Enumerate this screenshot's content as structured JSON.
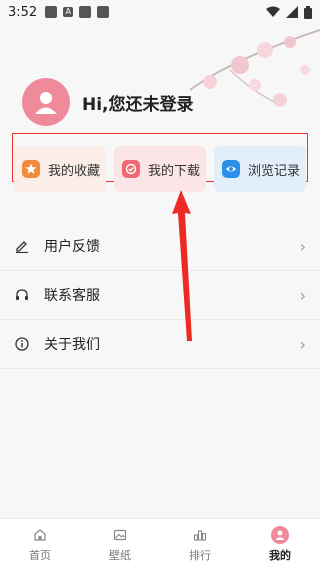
{
  "status": {
    "time": "3:52",
    "notif_letter": "A"
  },
  "profile": {
    "greeting": "Hi,您还未登录"
  },
  "quick": [
    {
      "label": "我的收藏",
      "icon": "star-icon",
      "color": "#f08a3c"
    },
    {
      "label": "我的下载",
      "icon": "check-icon",
      "color": "#ee6873"
    },
    {
      "label": "浏览记录",
      "icon": "eye-icon",
      "color": "#2d8ee8"
    }
  ],
  "menu": [
    {
      "label": "用户反馈",
      "icon": "edit-icon"
    },
    {
      "label": "联系客服",
      "icon": "headset-icon"
    },
    {
      "label": "关于我们",
      "icon": "info-icon"
    }
  ],
  "tabs": [
    {
      "label": "首页",
      "icon": "home-icon"
    },
    {
      "label": "壁纸",
      "icon": "image-icon"
    },
    {
      "label": "排行",
      "icon": "ranking-icon"
    },
    {
      "label": "我的",
      "icon": "user-icon",
      "active": true
    }
  ],
  "colors": {
    "accent": "#ef8a9b",
    "highlight_box": "#e33333"
  }
}
